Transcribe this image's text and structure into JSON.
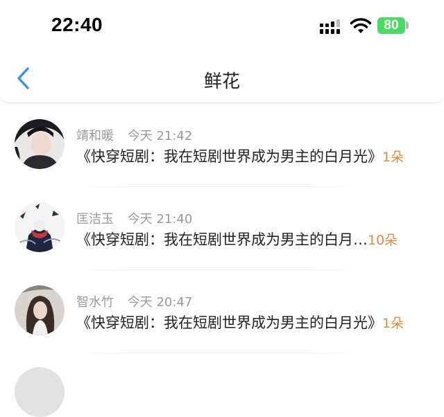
{
  "status_bar": {
    "time": "22:40",
    "battery": "80"
  },
  "nav": {
    "title": "鲜花"
  },
  "items": [
    {
      "name": "靖和暖",
      "time": "今天 21:42",
      "book": "《快穿短剧：我在短剧世界成为男主的白月光》",
      "qty": "1朵"
    },
    {
      "name": "匡洁玉",
      "time": "今天 21:40",
      "book": "《快穿短剧：我在短剧世界成为男主的白月…",
      "qty": "10朵"
    },
    {
      "name": "智水竹",
      "time": "今天 20:47",
      "book": "《快穿短剧：我在短剧世界成为男主的白月光》",
      "qty": "1朵"
    }
  ],
  "colors": {
    "accent": "#e28a3c",
    "back": "#2f8ff0",
    "battery": "#4cd964"
  }
}
